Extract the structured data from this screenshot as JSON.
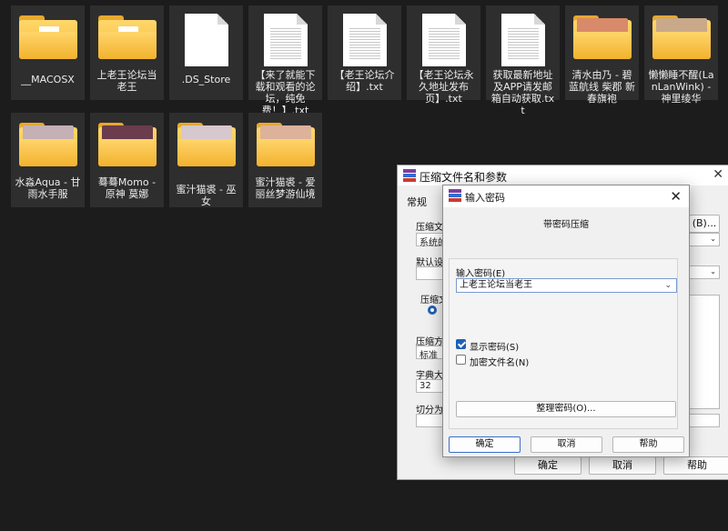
{
  "files": [
    {
      "name": "__MACOSX",
      "kind": "folder"
    },
    {
      "name": "上老王论坛当老王",
      "kind": "folder"
    },
    {
      "name": ".DS_Store",
      "kind": "file"
    },
    {
      "name": "【来了就能下载和观看的论坛，纯免费！】.txt",
      "kind": "text"
    },
    {
      "name": "【老王论坛介绍】.txt",
      "kind": "text"
    },
    {
      "name": "【老王论坛永久地址发布页】.txt",
      "kind": "text"
    },
    {
      "name": "获取最新地址及APP请发邮箱自动获取.txt",
      "kind": "text"
    },
    {
      "name": "清水由乃 - 碧蓝航线 柴郡 新春旗袍",
      "kind": "photo-folder",
      "color": "#d88a6a"
    },
    {
      "name": "懒懒睡不醒(LanLanWink) - 神里绫华",
      "kind": "photo-folder",
      "color": "#c9a98a"
    },
    {
      "name": "水淼Aqua - 甘雨水手服",
      "kind": "photo-folder",
      "color": "#c5b0b5"
    },
    {
      "name": "蓦蓦Momo - 原神 莫娜",
      "kind": "photo-folder",
      "color": "#6a3c4c"
    },
    {
      "name": "蜜汁猫裘 - 巫女",
      "kind": "photo-folder",
      "color": "#d6c8cc"
    },
    {
      "name": "蜜汁猫裘 - 爱丽丝梦游仙境",
      "kind": "photo-folder",
      "color": "#dcb39a"
    }
  ],
  "archive_dialog": {
    "title": "压缩文件名和参数",
    "tab": "常规",
    "archive_name_label": "压缩文",
    "browse_label": "(B)...",
    "profile_value": "系统的",
    "default_label": "默认设",
    "format_label": "压缩文",
    "method_label": "压缩方",
    "method_value": "标准",
    "dict_label": "字典大",
    "dict_value": "32",
    "split_label": "切分为",
    "ok": "确定",
    "cancel": "取消",
    "help": "帮助"
  },
  "password_dialog": {
    "title": "输入密码",
    "subtitle": "带密码压缩",
    "password_label": "输入密码(E)",
    "password_value": "上老王论坛当老王",
    "show_password_label": "显示密码(S)",
    "show_password_checked": true,
    "encrypt_names_label": "加密文件名(N)",
    "encrypt_names_checked": false,
    "organize_button": "整理密码(O)...",
    "ok": "确定",
    "cancel": "取消",
    "help": "帮助"
  }
}
